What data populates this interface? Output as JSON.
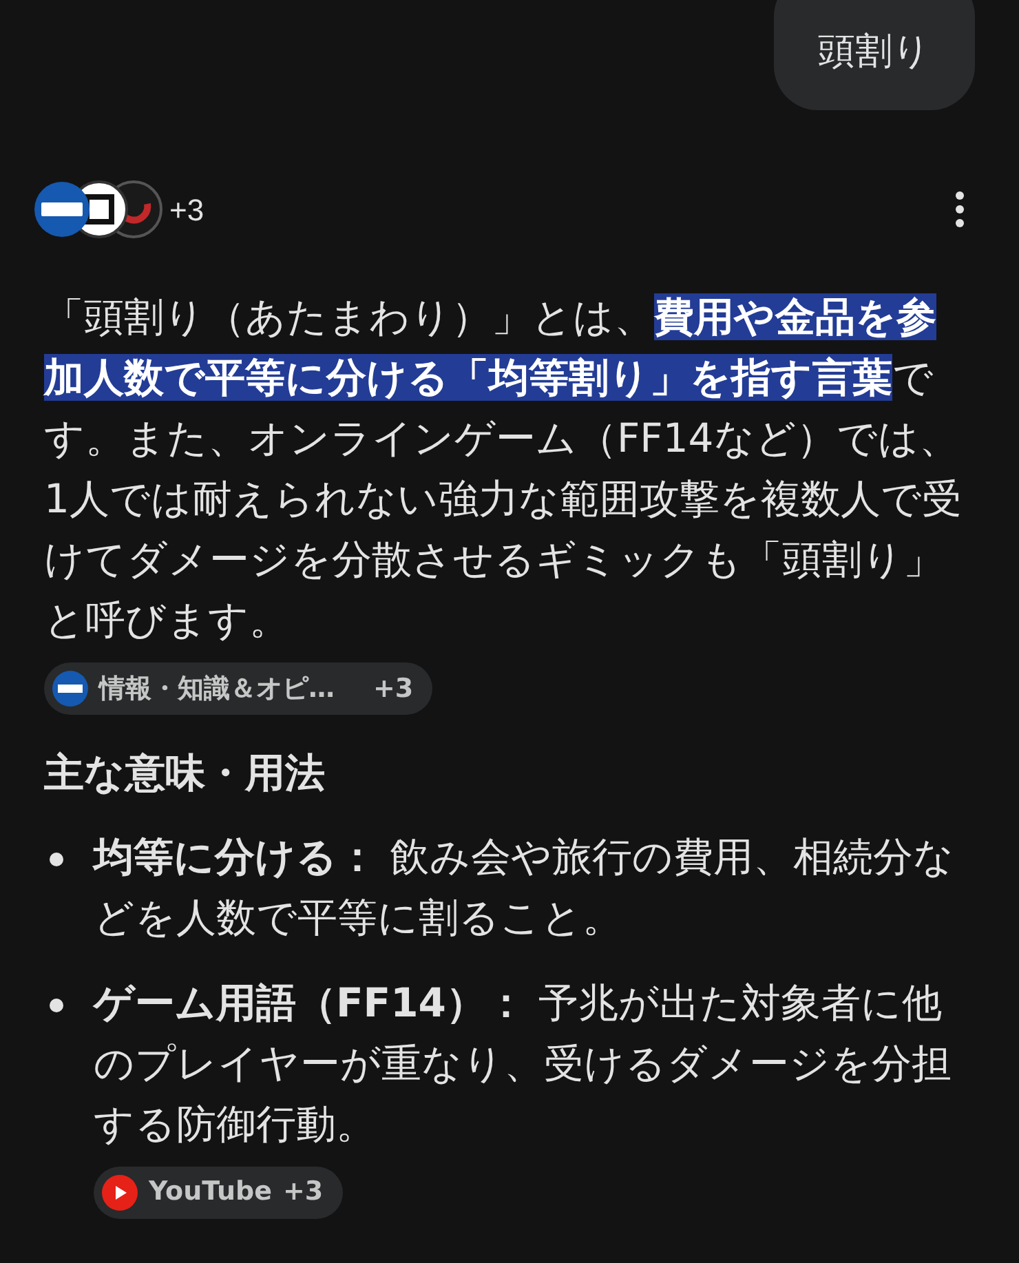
{
  "user_message": "頭割り",
  "sources": {
    "more": "+3"
  },
  "answer": {
    "paragraph": "「頭割り（あたまわり）」とは、**費用や金品を参加人数で平等に分ける「均等割り」を指す言葉**です。また、オンラインゲーム（FF14など）では、1人では耐えられない強力な範囲攻撃を複数人で受けてダメージを分散させるギミックも「頭割り」と呼びます。",
    "citation": {
      "label": "情報・知識＆オピ…",
      "more": "+3"
    },
    "section_heading": "主な意味・用法",
    "bullets": [
      {
        "text": "**均等に分ける：** 飲み会や旅行の費用、相続分などを人数で平等に割ること。"
      },
      {
        "text": "**ゲーム用語（FF14）：** 予兆が出た対象者に他のプレイヤーが重なり、受けるダメージを分担する防御行動。",
        "citation": {
          "label": "YouTube",
          "more": "+3"
        }
      }
    ]
  }
}
